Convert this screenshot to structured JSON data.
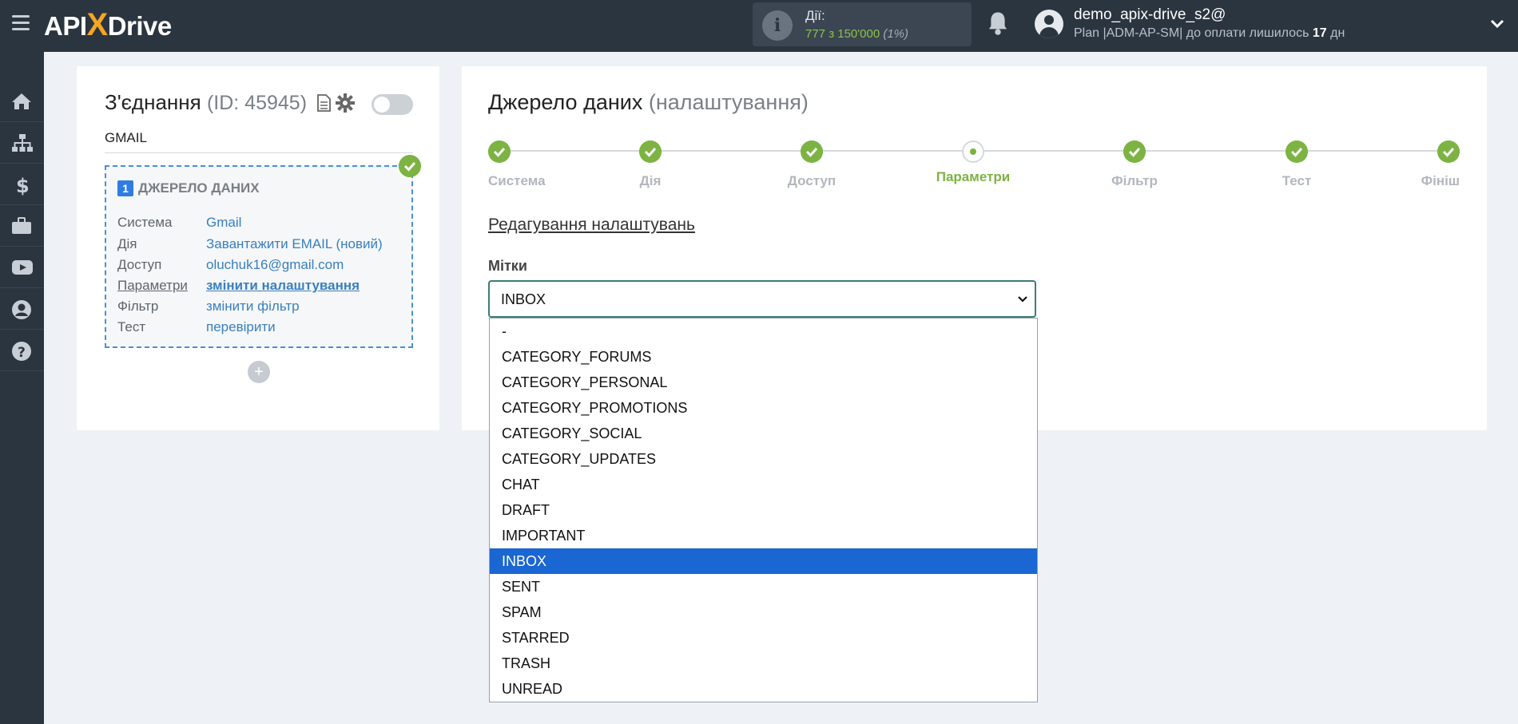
{
  "header": {
    "logo": {
      "part1": "API",
      "part2": "X",
      "part3": "Drive"
    },
    "actions_label": "Дії:",
    "actions_value": "777 з 150'000",
    "actions_percent": "(1%)",
    "user_name": "demo_apix-drive_s2@",
    "user_plan": "Plan |ADM-AP-SM| до оплати лишилось ",
    "user_days": "17",
    "user_days_suffix": " дн"
  },
  "sidebar": {
    "items": [
      "home-icon",
      "sitemap-icon",
      "dollar-icon",
      "briefcase-icon",
      "youtube-icon",
      "user-icon",
      "help-icon"
    ]
  },
  "connection": {
    "title": "З'єднання",
    "id_text": "(ID: 45945)",
    "name": "GMAIL",
    "source_num": "1",
    "source_heading": "ДЖЕРЕЛО ДАНИХ",
    "rows": [
      {
        "key": "Система",
        "value": "Gmail"
      },
      {
        "key": "Дія",
        "value": "Завантажити EMAIL (новий)"
      },
      {
        "key": "Доступ",
        "value": "oluchuk16@gmail.com"
      },
      {
        "key": "Параметри",
        "value": "змінити налаштування"
      },
      {
        "key": "Фільтр",
        "value": "змінити фільтр"
      },
      {
        "key": "Тест",
        "value": "перевірити"
      }
    ],
    "add_label": "+"
  },
  "datasource": {
    "title": "Джерело даних",
    "subtitle": "(налаштування)",
    "steps": [
      "Система",
      "Дія",
      "Доступ",
      "Параметри",
      "Фільтр",
      "Тест",
      "Фініш"
    ],
    "current_step": 3,
    "edit_title": "Редагування налаштувань",
    "labels_caption": "Мітки",
    "selected_label": "INBOX",
    "options": [
      "-",
      "CATEGORY_FORUMS",
      "CATEGORY_PERSONAL",
      "CATEGORY_PROMOTIONS",
      "CATEGORY_SOCIAL",
      "CATEGORY_UPDATES",
      "CHAT",
      "DRAFT",
      "IMPORTANT",
      "INBOX",
      "SENT",
      "SPAM",
      "STARRED",
      "TRASH",
      "UNREAD"
    ]
  },
  "colors": {
    "topbar": "#2b3540",
    "accent_green": "#7cb342",
    "link_blue": "#3a7fbf",
    "selected_option": "#1a66d2"
  }
}
